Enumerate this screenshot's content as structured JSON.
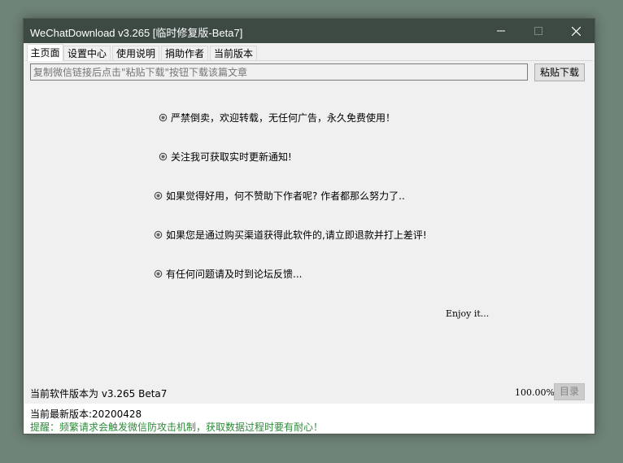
{
  "window": {
    "title": "WeChatDownload v3.265 [临时修复版-Beta7]"
  },
  "tabs": [
    {
      "label": "主页面"
    },
    {
      "label": "设置中心"
    },
    {
      "label": "使用说明"
    },
    {
      "label": "捐助作者"
    },
    {
      "label": "当前版本"
    }
  ],
  "url_input": {
    "placeholder": "复制微信链接后点击\"粘贴下载\"按钮下载该篇文章"
  },
  "paste_button": {
    "label": "粘贴下载"
  },
  "notices": [
    {
      "text": "严禁倒卖，欢迎转载，无任何广告，永久免费使用！"
    },
    {
      "text": "关注我可获取实时更新通知!"
    },
    {
      "text": "如果觉得好用，何不赞助下作者呢? 作者都那么努力了.."
    },
    {
      "text": "如果您是通过购买渠道获得此软件的,请立即退款并打上差评!"
    },
    {
      "text": "有任何问题请及时到论坛反馈..."
    }
  ],
  "enjoy_text": "Enjoy it...",
  "status": {
    "version_label": "当前软件版本为 v3.265 Beta7",
    "zoom_level": "100.00%",
    "toc_button": "目录"
  },
  "footer": {
    "latest_version": "当前最新版本:20200428",
    "warning": "提醒：频繁请求会触发微信防攻击机制，获取数据过程时要有耐心！"
  },
  "colors": {
    "titlebar": "#3d4a44",
    "warning_text": "#2e8b3a",
    "desktop": "#6f8478"
  },
  "icons": {
    "notice_bullet": "circle-dot-icon",
    "minimize": "minimize-icon",
    "maximize": "maximize-icon",
    "close": "close-icon"
  }
}
